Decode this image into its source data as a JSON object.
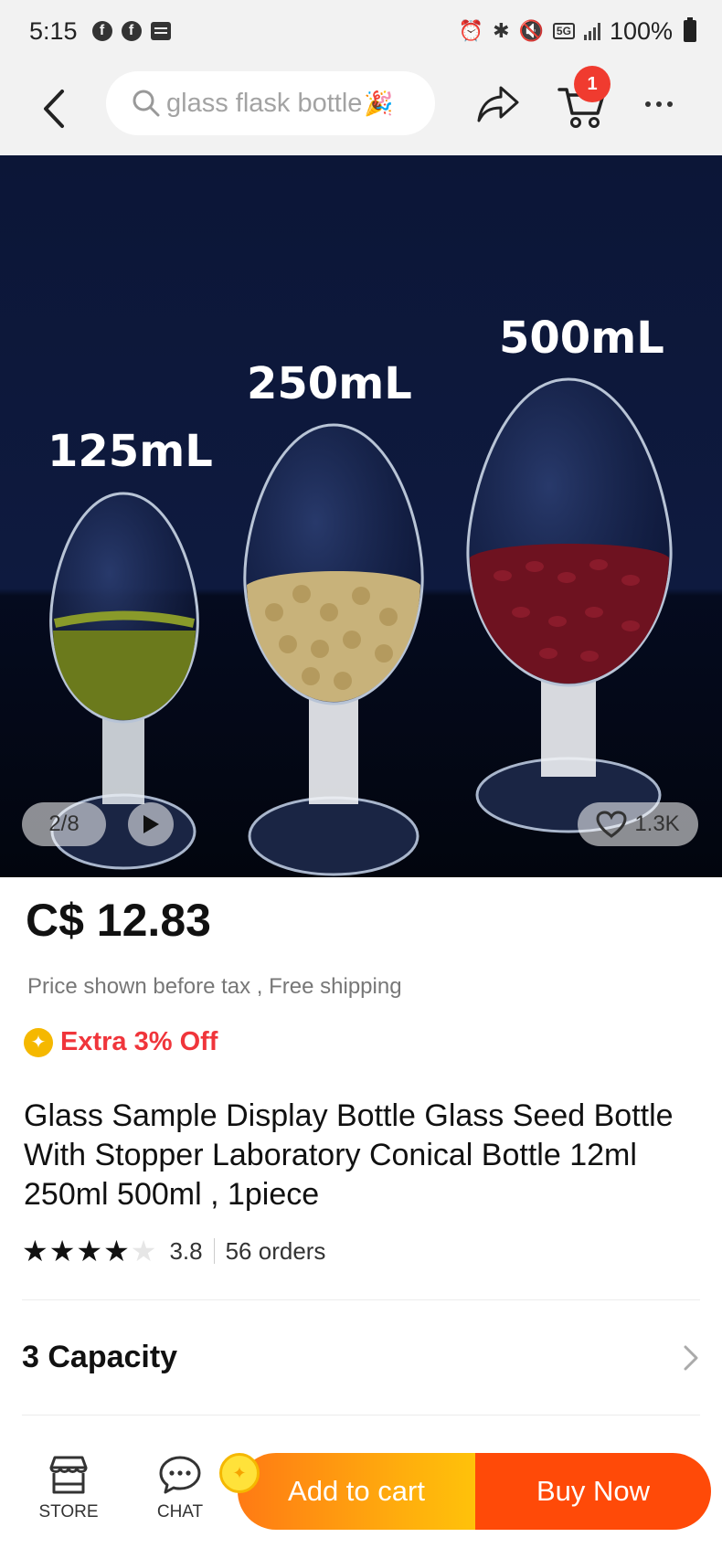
{
  "status_bar": {
    "time": "5:15",
    "network": "5G",
    "battery": "100%"
  },
  "header": {
    "search_placeholder": "glass flask bottle",
    "cart_count": "1"
  },
  "gallery": {
    "image_text": [
      "125mL",
      "250mL",
      "500mL"
    ],
    "counter": "2/8",
    "likes": "1.3K"
  },
  "product": {
    "price": "C$ 12.83",
    "price_note": "Price shown before tax , Free shipping",
    "promo": "Extra 3% Off",
    "title": "Glass Sample Display Bottle Glass Seed Bottle With Stopper Laboratory Conical Bottle 12ml 250ml 500ml , 1piece",
    "rating": "3.8",
    "rating_value": 3.8,
    "orders": "56 orders"
  },
  "options": {
    "capacity_label": "3 Capacity"
  },
  "bottom_bar": {
    "store_label": "STORE",
    "chat_label": "CHAT",
    "add_to_cart_label": "Add to cart",
    "buy_now_label": "Buy Now"
  },
  "colors": {
    "accent_red": "#f03b2f",
    "promo_red": "#f0353b",
    "buy_now": "#ff4a08",
    "add_to_cart_orange": "#ffae0d",
    "image_background": "#0c1637"
  }
}
